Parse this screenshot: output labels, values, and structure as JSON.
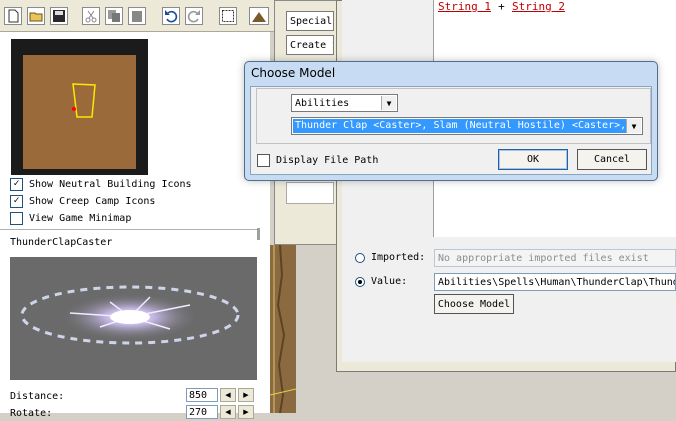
{
  "toolbar": {
    "icons": [
      "new-icon",
      "open-icon",
      "save-icon",
      "cut-icon",
      "copy-icon",
      "paste-icon",
      "undo-icon",
      "redo-icon",
      "select-icon",
      "terrain-icon"
    ]
  },
  "left_panel": {
    "checkboxes": [
      {
        "label": "Show Neutral Building Icons",
        "checked": true
      },
      {
        "label": "Show Creep Camp Icons",
        "checked": true
      },
      {
        "label": "View Game Minimap",
        "checked": false
      }
    ],
    "model_name": "ThunderClapCaster",
    "distance_label": "Distance:",
    "distance_value": "850",
    "rotate_label": "Rotate:",
    "rotate_value": "270"
  },
  "back_window": {
    "buttons": [
      "Special",
      "Create S"
    ]
  },
  "properties": {
    "string1": "String 1",
    "plus": "+",
    "string2": "String 2",
    "imported_label": "Imported:",
    "imported_placeholder": "No appropriate imported files exist",
    "value_label": "Value:",
    "value_text": "Abilities\\Spells\\Human\\ThunderClap\\Thund",
    "choose_model_button": "Choose Model"
  },
  "choose_model_dialog": {
    "title": "Choose Model",
    "category": "Abilities",
    "model": "Thunder Clap <Caster>, Slam (Neutral Hostile) <Caster>,",
    "display_file_path_label": "Display File Path",
    "display_file_path_checked": false,
    "ok_label": "OK",
    "cancel_label": "Cancel"
  },
  "colors": {
    "selection": "#3399ff",
    "link": "#c00000",
    "dialog_frame": "#c7dcf2",
    "terrain": "#9b6a3a"
  }
}
